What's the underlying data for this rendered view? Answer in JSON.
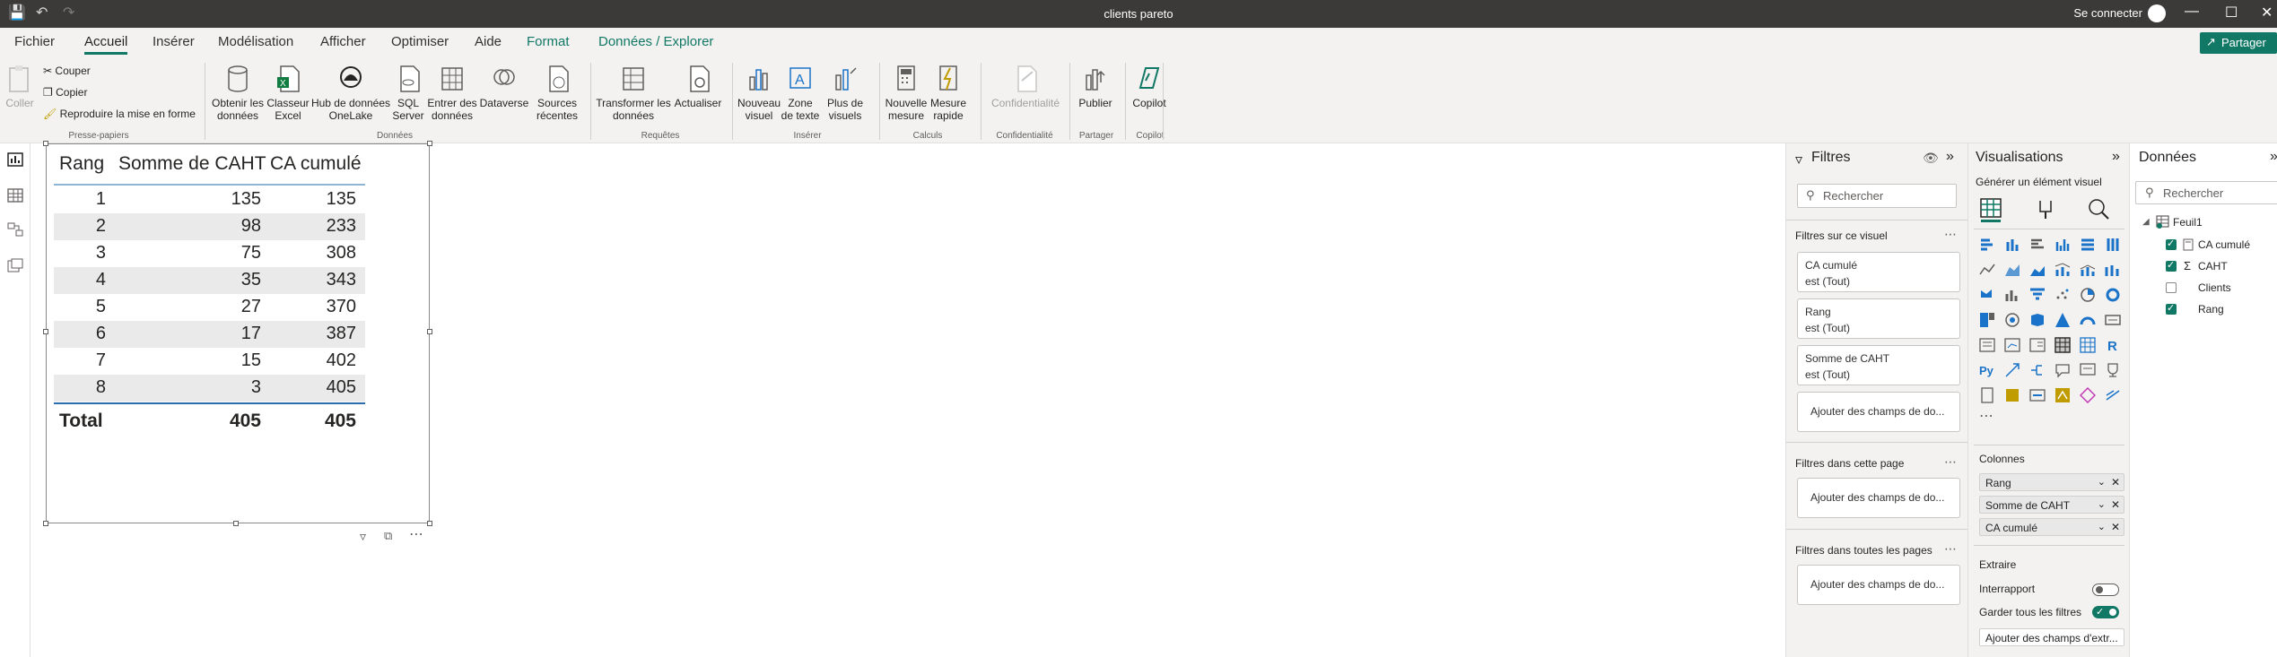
{
  "window": {
    "title": "clients pareto",
    "sign_in": "Se connecter"
  },
  "menubar": {
    "tabs": [
      "Fichier",
      "Accueil",
      "Insérer",
      "Modélisation",
      "Afficher",
      "Optimiser",
      "Aide",
      "Format",
      "Données / Explorer"
    ],
    "active": "Accueil",
    "share": "Partager"
  },
  "ribbon": {
    "clipboard": {
      "paste": "Coller",
      "cut": "Couper",
      "copy": "Copier",
      "format_painter": "Reproduire la mise en forme",
      "label": "Presse-papiers"
    },
    "data": {
      "get_data": "Obtenir les données",
      "excel": "Classeur Excel",
      "onelake": "Hub de données OneLake",
      "sql": "SQL Server",
      "enter": "Entrer des données",
      "dataverse": "Dataverse",
      "recent": "Sources récentes",
      "label": "Données"
    },
    "queries": {
      "transform": "Transformer les données",
      "refresh": "Actualiser",
      "label": "Requêtes"
    },
    "insert": {
      "new_visual": "Nouveau visuel",
      "text_box": "Zone de texte",
      "more": "Plus de visuels",
      "label": "Insérer"
    },
    "calc": {
      "new_measure": "Nouvelle mesure",
      "quick_measure": "Mesure rapide",
      "label": "Calculs"
    },
    "sensitivity": {
      "btn": "Confidentialité",
      "label": "Confidentialité"
    },
    "share": {
      "publish": "Publier",
      "label": "Partager"
    },
    "copilot": {
      "btn": "Copilot",
      "label": "Copilot"
    }
  },
  "table": {
    "headers": [
      "Rang",
      "Somme de CAHT",
      "CA cumulé"
    ],
    "rows": [
      [
        "1",
        "135",
        "135"
      ],
      [
        "2",
        "98",
        "233"
      ],
      [
        "3",
        "75",
        "308"
      ],
      [
        "4",
        "35",
        "343"
      ],
      [
        "5",
        "27",
        "370"
      ],
      [
        "6",
        "17",
        "387"
      ],
      [
        "7",
        "15",
        "402"
      ],
      [
        "8",
        "3",
        "405"
      ]
    ],
    "total": [
      "Total",
      "405",
      "405"
    ]
  },
  "filters": {
    "title": "Filtres",
    "search_placeholder": "Rechercher",
    "visual_section": "Filtres sur ce visuel",
    "cards": [
      {
        "field": "CA cumulé",
        "state": "est (Tout)"
      },
      {
        "field": "Rang",
        "state": "est (Tout)"
      },
      {
        "field": "Somme de CAHT",
        "state": "est (Tout)"
      }
    ],
    "add_fields": "Ajouter des champs de do...",
    "page_section": "Filtres dans cette page",
    "all_pages_section": "Filtres dans toutes les pages"
  },
  "visualizations": {
    "title": "Visualisations",
    "subtitle": "Générer un élément visuel",
    "columns_label": "Colonnes",
    "wells": [
      "Rang",
      "Somme de CAHT",
      "CA cumulé"
    ],
    "drill_label": "Extraire",
    "cross_report": "Interrapport",
    "cross_report_on": false,
    "keep_filters": "Garder tous les filtres",
    "keep_filters_on": true,
    "add_drill": "Ajouter des champs d'extr...",
    "accent": "#117865"
  },
  "data_pane": {
    "title": "Données",
    "search_placeholder": "Rechercher",
    "table_name": "Feuil1",
    "fields": [
      {
        "name": "CA cumulé",
        "checked": true,
        "icon": "calc-icon"
      },
      {
        "name": "CAHT",
        "checked": true,
        "icon": "sigma-icon"
      },
      {
        "name": "Clients",
        "checked": false,
        "icon": ""
      },
      {
        "name": "Rang",
        "checked": true,
        "icon": ""
      }
    ]
  }
}
